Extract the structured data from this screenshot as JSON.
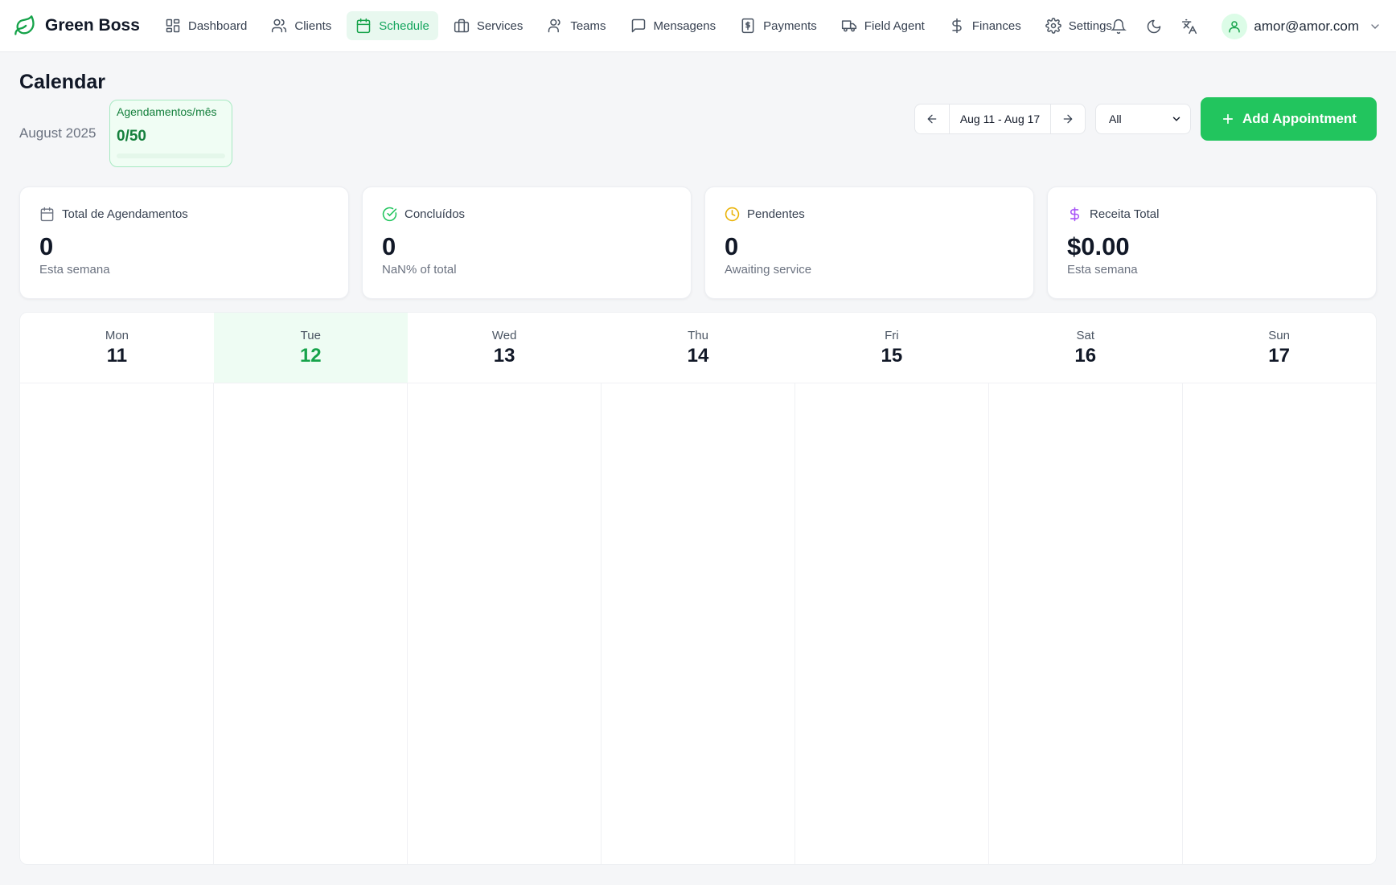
{
  "brand": {
    "name": "Green Boss"
  },
  "nav": {
    "items": [
      {
        "label": "Dashboard",
        "icon": "dashboard-icon",
        "active": false
      },
      {
        "label": "Clients",
        "icon": "users-icon",
        "active": false
      },
      {
        "label": "Schedule",
        "icon": "calendar-icon",
        "active": true
      },
      {
        "label": "Services",
        "icon": "briefcase-icon",
        "active": false
      },
      {
        "label": "Teams",
        "icon": "team-icon",
        "active": false
      },
      {
        "label": "Mensagens",
        "icon": "message-icon",
        "active": false
      },
      {
        "label": "Payments",
        "icon": "receipt-icon",
        "active": false
      },
      {
        "label": "Field Agent",
        "icon": "truck-icon",
        "active": false
      },
      {
        "label": "Finances",
        "icon": "dollar-icon",
        "active": false
      },
      {
        "label": "Settings",
        "icon": "gear-icon",
        "active": false
      }
    ]
  },
  "user": {
    "email": "amor@amor.com"
  },
  "header": {
    "title": "Calendar",
    "month": "August 2025",
    "quota": {
      "label": "Agendamentos/mês",
      "value": "0/50",
      "used": 0,
      "limit": 50
    },
    "week_range": "Aug 11 - Aug 17",
    "filter": {
      "selected": "All"
    },
    "add_button": "Add Appointment"
  },
  "stats": [
    {
      "icon": "calendar-icon",
      "icon_color": "#6b7280",
      "label": "Total de Agendamentos",
      "value": "0",
      "sub": "Esta semana"
    },
    {
      "icon": "check-circle-icon",
      "icon_color": "#22c55e",
      "label": "Concluídos",
      "value": "0",
      "sub": "NaN% of total"
    },
    {
      "icon": "clock-icon",
      "icon_color": "#eab308",
      "label": "Pendentes",
      "value": "0",
      "sub": "Awaiting service"
    },
    {
      "icon": "dollar-icon",
      "icon_color": "#a855f7",
      "label": "Receita Total",
      "value": "$0.00",
      "sub": "Esta semana"
    }
  ],
  "calendar": {
    "days": [
      {
        "name": "Mon",
        "num": "11",
        "today": false
      },
      {
        "name": "Tue",
        "num": "12",
        "today": true
      },
      {
        "name": "Wed",
        "num": "13",
        "today": false
      },
      {
        "name": "Thu",
        "num": "14",
        "today": false
      },
      {
        "name": "Fri",
        "num": "15",
        "today": false
      },
      {
        "name": "Sat",
        "num": "16",
        "today": false
      },
      {
        "name": "Sun",
        "num": "17",
        "today": false
      }
    ]
  },
  "colors": {
    "accent": "#22c55e",
    "accent_text": "#15a55e",
    "today_bg": "#eefcf3"
  }
}
